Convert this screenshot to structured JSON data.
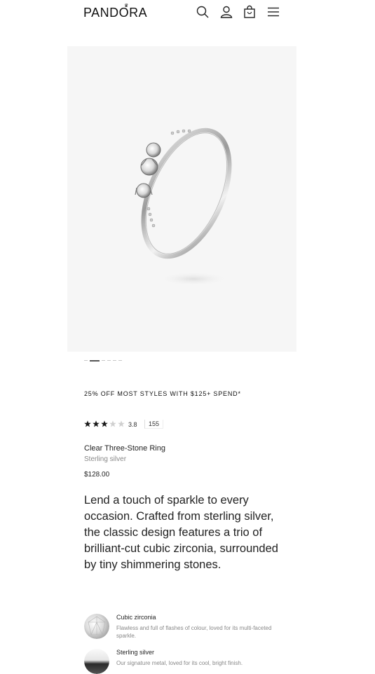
{
  "header": {
    "brand": "PANDORA",
    "icons": [
      "search-icon",
      "account-icon",
      "bag-icon",
      "menu-icon"
    ]
  },
  "gallery": {
    "slide_count": 6,
    "active_slide": 2
  },
  "promo": {
    "text": "25% OFF MOST STYLES WITH $125+ SPEND*"
  },
  "rating": {
    "stars": 3.8,
    "value": "3.8",
    "count": "155"
  },
  "product": {
    "name": "Clear Three-Stone Ring",
    "material": "Sterling silver",
    "price": "$128.00",
    "description": "Lend a touch of sparkle to every occasion. Crafted from sterling silver, the classic design features a trio of brilliant-cut cubic zirconia, surrounded by tiny shimmering stones."
  },
  "features": [
    {
      "title": "Cubic zirconia",
      "description": "Flawless and full of flashes of colour, loved for its multi-faceted sparkle.",
      "icon": "cubic-zirconia-thumbnail"
    },
    {
      "title": "Sterling silver",
      "description": "Our signature metal, loved for its cool, bright finish.",
      "icon": "sterling-silver-thumbnail"
    }
  ],
  "colors": {
    "star_filled": "#1a1a1a",
    "star_empty": "#d0d0d0",
    "media_bg": "#f6f6f6"
  }
}
